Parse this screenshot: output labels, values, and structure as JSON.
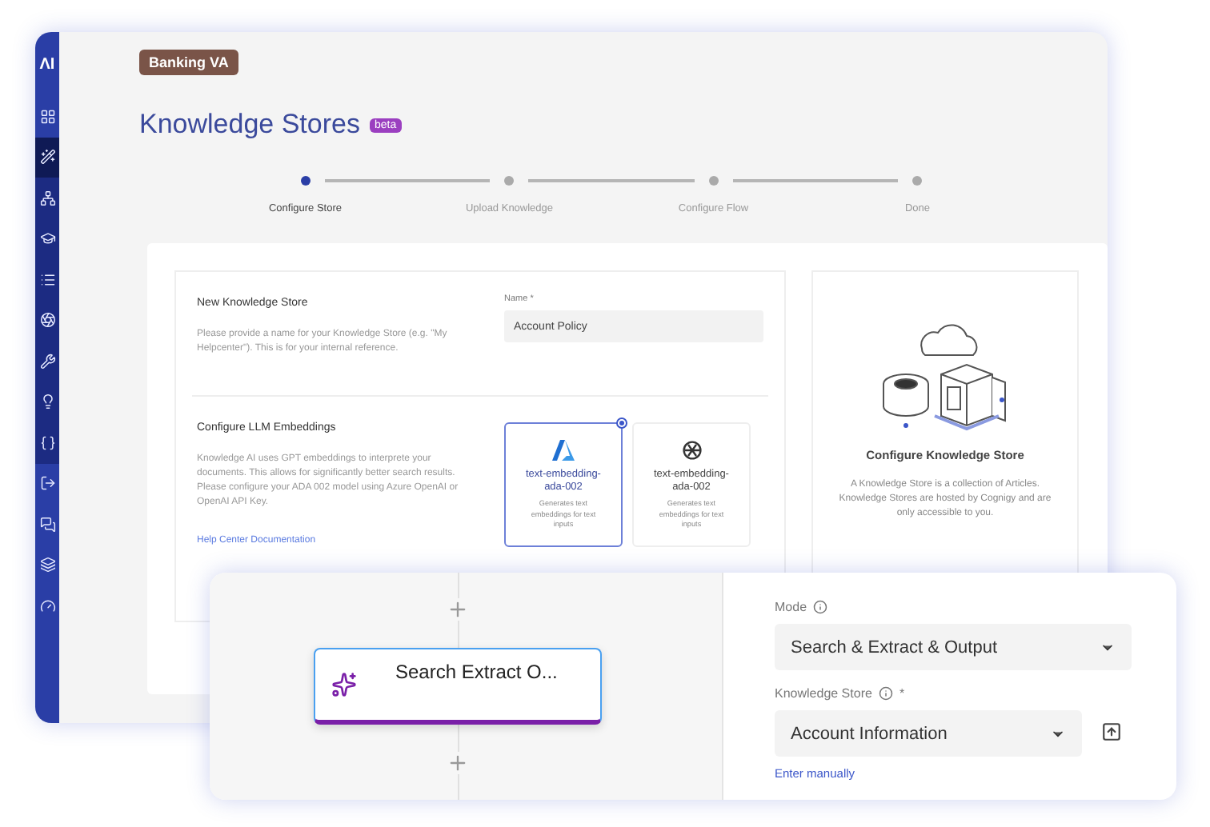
{
  "sidebar": {
    "logo": "ΛI",
    "items": [
      {
        "kind": "global",
        "selected": false
      },
      {
        "kind": "project",
        "selected": true
      },
      {
        "kind": "project",
        "selected": false
      },
      {
        "kind": "project",
        "selected": false
      },
      {
        "kind": "project",
        "selected": false
      },
      {
        "kind": "project",
        "selected": false
      },
      {
        "kind": "project",
        "selected": false
      },
      {
        "kind": "project",
        "selected": false
      },
      {
        "kind": "project",
        "selected": false
      },
      {
        "kind": "global",
        "selected": false
      },
      {
        "kind": "global",
        "selected": false
      },
      {
        "kind": "global",
        "selected": false
      },
      {
        "kind": "global",
        "selected": false
      }
    ]
  },
  "project_badge": "Banking VA",
  "page": {
    "title": "Knowledge Stores",
    "badge": "beta"
  },
  "steps": [
    {
      "label": "Configure Store",
      "selected": true
    },
    {
      "label": "Upload Knowledge",
      "selected": false
    },
    {
      "label": "Configure Flow",
      "selected": false
    },
    {
      "label": "Done",
      "selected": false
    }
  ],
  "name_section": {
    "title": "New Knowledge Store",
    "description": "Please provide a name for your Knowledge Store (e.g. \"My Helpcenter\"). This is for your internal reference.",
    "field": {
      "label": "Name *",
      "value": "Account Policy"
    }
  },
  "embeddings_section": {
    "title": "Configure LLM Embeddings",
    "description": "Knowledge AI uses GPT embeddings to interprete your documents. This allows for significantly better search results. Please configure your ADA 002 model using Azure OpenAI or OpenAI API Key.",
    "link": "Help Center Documentation",
    "options": [
      {
        "kind": "azure",
        "title": "text-embedding-ada-002",
        "description": "Generates text embeddings for text inputs",
        "selected": true
      },
      {
        "kind": "openai",
        "title": "text-embedding-ada-002",
        "description": "Generates text embeddings for text inputs",
        "selected": false
      }
    ]
  },
  "info_panel": {
    "title": "Configure Knowledge Store",
    "description": "A Knowledge Store is a collection of Articles. Knowledge Stores are hosted by Cognigy and are only accessible to you."
  },
  "flow_panel": {
    "node": {
      "label": "Search Extract O..."
    },
    "mode": {
      "label": "Mode",
      "value": "Search & Extract & Output"
    },
    "knowledge_store": {
      "label": "Knowledge Store",
      "required_mark": "*",
      "value": "Account Information",
      "link": "Enter manually"
    }
  }
}
